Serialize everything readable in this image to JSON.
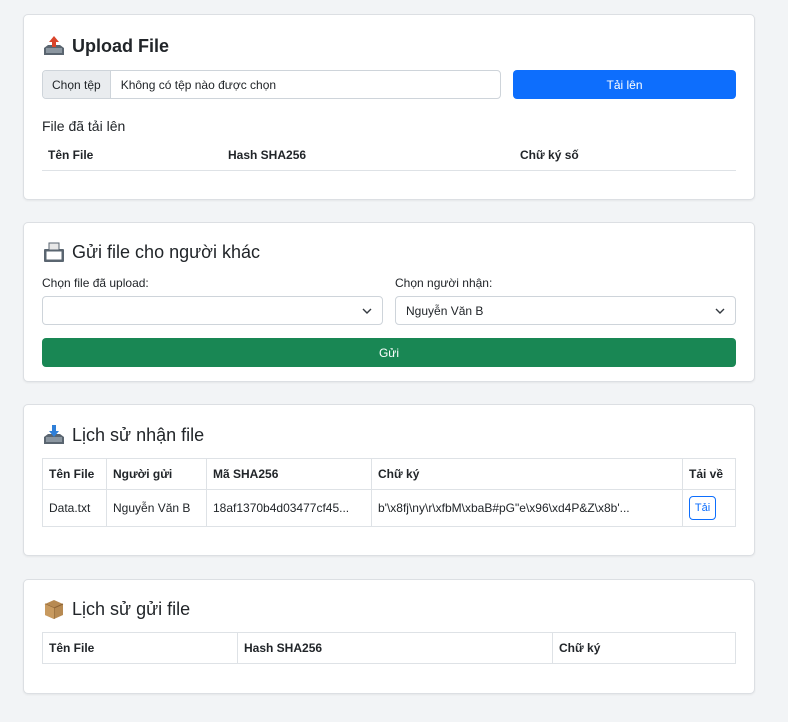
{
  "upload": {
    "title": "Upload File",
    "icon": "outbox-tray-icon",
    "choose_file_label": "Chọn tệp",
    "no_file_text": "Không có tệp nào được chọn",
    "upload_button": "Tải lên",
    "uploaded_title": "File đã tải lên",
    "columns": [
      "Tên File",
      "Hash SHA256",
      "Chữ ký số"
    ]
  },
  "send": {
    "title": "Gửi file cho người khác",
    "icon": "fax-icon",
    "file_label": "Chọn file đã upload:",
    "file_value": "",
    "recipient_label": "Chọn người nhận:",
    "recipient_value": "Nguyễn Văn B",
    "send_button": "Gửi"
  },
  "received": {
    "title": "Lịch sử nhận file",
    "icon": "inbox-tray-icon",
    "columns": [
      "Tên File",
      "Người gửi",
      "Mã SHA256",
      "Chữ ký",
      "Tải về"
    ],
    "rows": [
      {
        "file": "Data.txt",
        "sender": "Nguyễn Văn B",
        "sha": "18af1370b4d03477cf45...",
        "signature": "b'\\x8fj\\ny\\r\\xfbM\\xbaB#pG\"e\\x96\\xd4P&Z\\x8b'...",
        "download": "Tải"
      }
    ]
  },
  "sent": {
    "title": "Lịch sử gửi file",
    "icon": "package-icon",
    "columns": [
      "Tên File",
      "Hash SHA256",
      "Chữ ký"
    ]
  },
  "colors": {
    "primary": "#0d6efd",
    "success": "#198754",
    "background": "#f2f4f6"
  }
}
